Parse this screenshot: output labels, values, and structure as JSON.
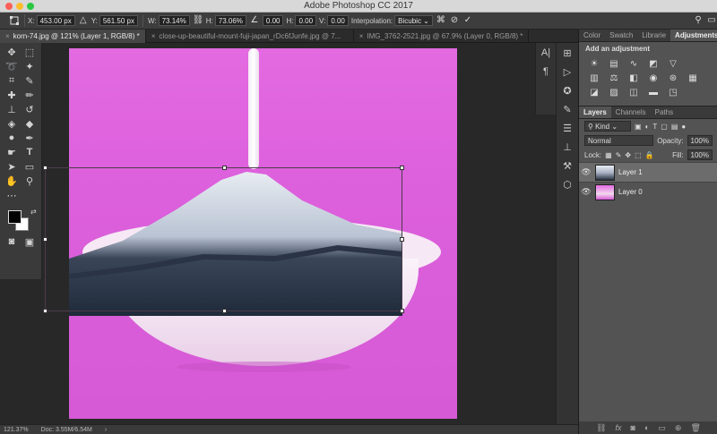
{
  "window": {
    "title": "Adobe Photoshop CC 2017"
  },
  "options": {
    "x_label": "X:",
    "x_value": "453.00 px",
    "y_label": "Y:",
    "y_value": "561.50 px",
    "w_label": "W:",
    "w_value": "73.14%",
    "h_label": "H:",
    "h_value": "73.06%",
    "angle_value": "0.00",
    "hskew_label": "H:",
    "hskew_value": "0.00",
    "vskew_label": "V:",
    "vskew_value": "0.00",
    "interpolation_label": "Interpolation:",
    "interpolation_value": "Bicubic"
  },
  "doc_tabs": [
    {
      "label": "korn-74.jpg @ 121% (Layer 1, RGB/8) *",
      "active": true
    },
    {
      "label": "close-up-beautiful-mount-fuji-japan_rDc6fJunfe.jpg @ 7...",
      "active": false
    },
    {
      "label": "IMG_3762-2521.jpg @ 67.9% (Layer 0, RGB/8) *",
      "active": false
    }
  ],
  "status": {
    "zoom": "121.37%",
    "doc": "Doc: 3.55M/6.54M"
  },
  "adjust_panel": {
    "tabs": [
      "Color",
      "Swatch",
      "Librarie",
      "Adjustments"
    ],
    "active_tab": "Adjustments",
    "title": "Add an adjustment"
  },
  "layers_panel": {
    "tabs": [
      "Layers",
      "Channels",
      "Paths"
    ],
    "active_tab": "Layers",
    "filter_label": "Kind",
    "blend_mode": "Normal",
    "opacity_label": "Opacity:",
    "opacity_value": "100%",
    "lock_label": "Lock:",
    "fill_label": "Fill:",
    "fill_value": "100%",
    "layers": [
      {
        "name": "Layer 1",
        "selected": true
      },
      {
        "name": "Layer 0",
        "selected": false
      }
    ]
  },
  "colors": {
    "canvas_bg": "#dc5fdc",
    "foreground": "#000000",
    "background": "#ffffff"
  }
}
